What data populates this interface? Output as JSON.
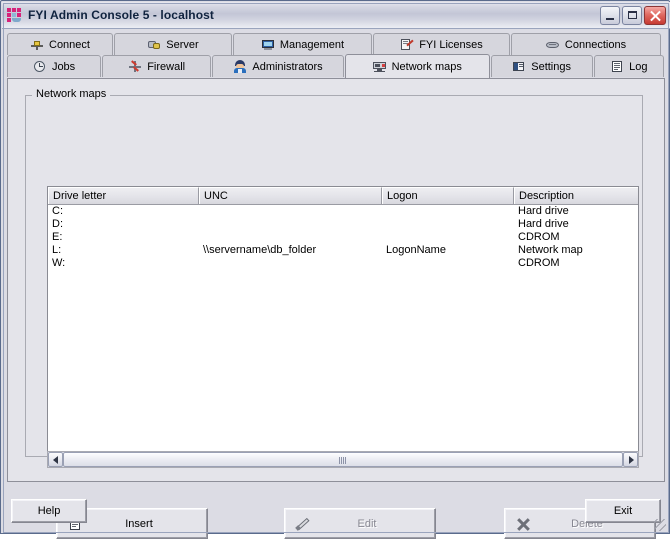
{
  "window": {
    "title": "FYI Admin Console 5 - localhost",
    "app_icon": "app-grid-icon",
    "controls": {
      "minimize": "_",
      "maximize": "□",
      "close": "×"
    }
  },
  "tabs": {
    "row1": [
      {
        "label": "Connect",
        "icon": "connect-icon",
        "selected": false
      },
      {
        "label": "Server",
        "icon": "server-icon",
        "selected": false
      },
      {
        "label": "Management",
        "icon": "management-icon",
        "selected": false
      },
      {
        "label": "FYI Licenses",
        "icon": "license-icon",
        "selected": false
      },
      {
        "label": "Connections",
        "icon": "connections-icon",
        "selected": false
      }
    ],
    "row2": [
      {
        "label": "Jobs",
        "icon": "jobs-icon",
        "selected": false
      },
      {
        "label": "Firewall",
        "icon": "firewall-icon",
        "selected": false
      },
      {
        "label": "Administrators",
        "icon": "administrators-icon",
        "selected": false
      },
      {
        "label": "Network maps",
        "icon": "network-maps-icon",
        "selected": true
      },
      {
        "label": "Settings",
        "icon": "settings-icon",
        "selected": false
      },
      {
        "label": "Log",
        "icon": "log-icon",
        "selected": false
      }
    ]
  },
  "groupbox": {
    "title": "Network maps"
  },
  "listview": {
    "columns": [
      "Drive letter",
      "UNC",
      "Logon",
      "Description"
    ],
    "rows": [
      {
        "drive": "C:",
        "unc": "",
        "logon": "",
        "description": "Hard drive"
      },
      {
        "drive": "D:",
        "unc": "",
        "logon": "",
        "description": "Hard drive"
      },
      {
        "drive": "E:",
        "unc": "",
        "logon": "",
        "description": "CDROM"
      },
      {
        "drive": "L:",
        "unc": "\\\\servername\\db_folder",
        "logon": "LogonName",
        "description": "Network map"
      },
      {
        "drive": "W:",
        "unc": "",
        "logon": "",
        "description": "CDROM"
      }
    ]
  },
  "scrollbar": {
    "left_arrow": "scroll-left-icon",
    "right_arrow": "scroll-right-icon",
    "grip": "scroll-thumb-grip"
  },
  "actions": {
    "insert": {
      "label": "Insert",
      "icon": "new-document-icon",
      "enabled": true
    },
    "edit": {
      "label": "Edit",
      "icon": "pencil-icon",
      "enabled": false
    },
    "delete": {
      "label": "Delete",
      "icon": "x-mark-icon",
      "enabled": false
    }
  },
  "footer": {
    "help": "Help",
    "exit": "Exit"
  },
  "colors": {
    "window_face": "#e4e4ea",
    "title_accent": "#10233f",
    "close_button": "#c63a32",
    "list_background": "#ffffff",
    "disabled_text": "#868690"
  }
}
